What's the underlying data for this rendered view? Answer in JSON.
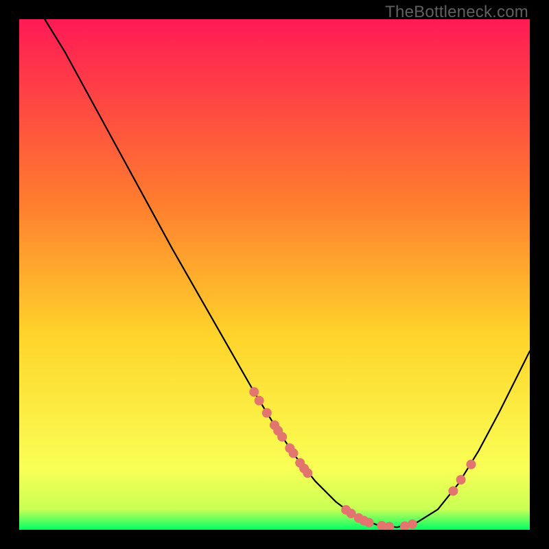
{
  "watermark": "TheBottleneck.com",
  "chart_data": {
    "type": "line",
    "title": "",
    "xlabel": "",
    "ylabel": "",
    "xlim": [
      0,
      100
    ],
    "ylim": [
      0,
      100
    ],
    "background_gradient": {
      "top": "#ff1a55",
      "mid1": "#ff7a2f",
      "mid2": "#ffd42a",
      "mid3": "#f9ff55",
      "bottom_band": "#00ff66"
    },
    "curve": [
      {
        "x": 5.0,
        "y": 100.0
      },
      {
        "x": 9.0,
        "y": 93.5
      },
      {
        "x": 12.0,
        "y": 88.0
      },
      {
        "x": 18.0,
        "y": 77.0
      },
      {
        "x": 24.0,
        "y": 66.0
      },
      {
        "x": 30.0,
        "y": 55.0
      },
      {
        "x": 36.0,
        "y": 44.5
      },
      {
        "x": 42.0,
        "y": 34.0
      },
      {
        "x": 46.0,
        "y": 27.0
      },
      {
        "x": 50.0,
        "y": 20.5
      },
      {
        "x": 54.0,
        "y": 14.5
      },
      {
        "x": 58.0,
        "y": 9.5
      },
      {
        "x": 62.0,
        "y": 5.5
      },
      {
        "x": 66.0,
        "y": 2.5
      },
      {
        "x": 70.0,
        "y": 1.0
      },
      {
        "x": 74.0,
        "y": 0.5
      },
      {
        "x": 78.0,
        "y": 1.5
      },
      {
        "x": 82.0,
        "y": 4.0
      },
      {
        "x": 86.0,
        "y": 9.0
      },
      {
        "x": 90.0,
        "y": 15.5
      },
      {
        "x": 94.0,
        "y": 23.0
      },
      {
        "x": 97.0,
        "y": 29.0
      },
      {
        "x": 100.0,
        "y": 35.0
      }
    ],
    "scatter": {
      "color": "#e2766f",
      "points": [
        {
          "x": 46.0,
          "y": 27.0
        },
        {
          "x": 47.0,
          "y": 25.3
        },
        {
          "x": 48.5,
          "y": 22.9
        },
        {
          "x": 50.0,
          "y": 20.5
        },
        {
          "x": 50.7,
          "y": 19.4
        },
        {
          "x": 51.5,
          "y": 18.2
        },
        {
          "x": 53.0,
          "y": 16.0
        },
        {
          "x": 53.7,
          "y": 15.0
        },
        {
          "x": 55.0,
          "y": 13.1
        },
        {
          "x": 55.8,
          "y": 12.0
        },
        {
          "x": 56.5,
          "y": 11.1
        },
        {
          "x": 64.0,
          "y": 3.9
        },
        {
          "x": 65.0,
          "y": 3.2
        },
        {
          "x": 66.5,
          "y": 2.3
        },
        {
          "x": 67.5,
          "y": 1.8
        },
        {
          "x": 68.5,
          "y": 1.4
        },
        {
          "x": 71.0,
          "y": 0.8
        },
        {
          "x": 72.5,
          "y": 0.6
        },
        {
          "x": 75.5,
          "y": 0.7
        },
        {
          "x": 77.0,
          "y": 1.1
        },
        {
          "x": 85.0,
          "y": 7.6
        },
        {
          "x": 86.5,
          "y": 9.8
        },
        {
          "x": 88.5,
          "y": 12.8
        }
      ]
    }
  }
}
